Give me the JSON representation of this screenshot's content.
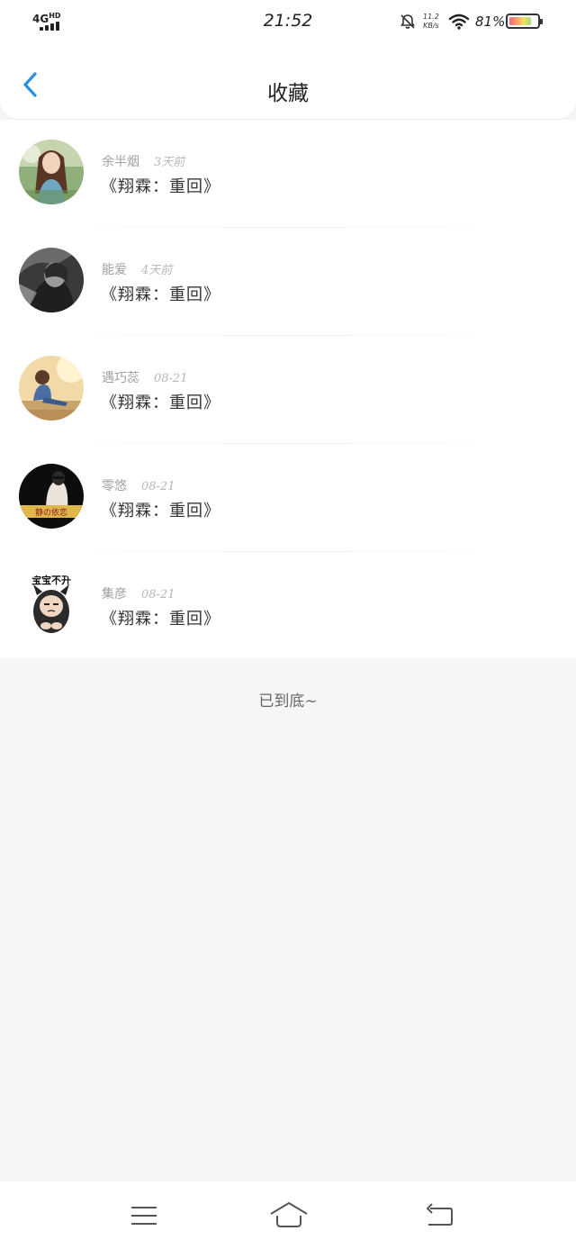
{
  "status_bar": {
    "network": "4G",
    "network_sup": "HD",
    "time": "21:52",
    "speed_value": "11.2",
    "speed_unit": "KB/s",
    "battery_percent": "81%",
    "battery_level": 0.81
  },
  "header": {
    "back_icon": "chevron-left-icon",
    "title": "收藏"
  },
  "favorites": [
    {
      "author": "余半烟",
      "time": "3天前",
      "title": "《翔霖：重回》",
      "avatar": "girl-outdoor"
    },
    {
      "author": "能爱",
      "time": "4天前",
      "title": "《翔霖：重回》",
      "avatar": "bw-portrait"
    },
    {
      "author": "遇巧蕊",
      "time": "08-21",
      "title": "《翔霖：重回》",
      "avatar": "sitting-outdoor"
    },
    {
      "author": "零悠",
      "time": "08-21",
      "title": "《翔霖：重回》",
      "avatar": "dark-photo"
    },
    {
      "author": "集彦",
      "time": "08-21",
      "title": "《翔霖：重回》",
      "avatar": "cat-sticker"
    }
  ],
  "avatar_texts": {
    "dark_photo_caption": "静の依恋",
    "cat_sticker_caption": "宝宝不开"
  },
  "end_text": "已到底~",
  "bottom_nav": {
    "menu_icon": "menu-icon",
    "home_icon": "home-icon",
    "back_icon": "back-arrow-icon"
  },
  "colors": {
    "accent": "#2b8fe0",
    "background": "#f7f6f7"
  }
}
